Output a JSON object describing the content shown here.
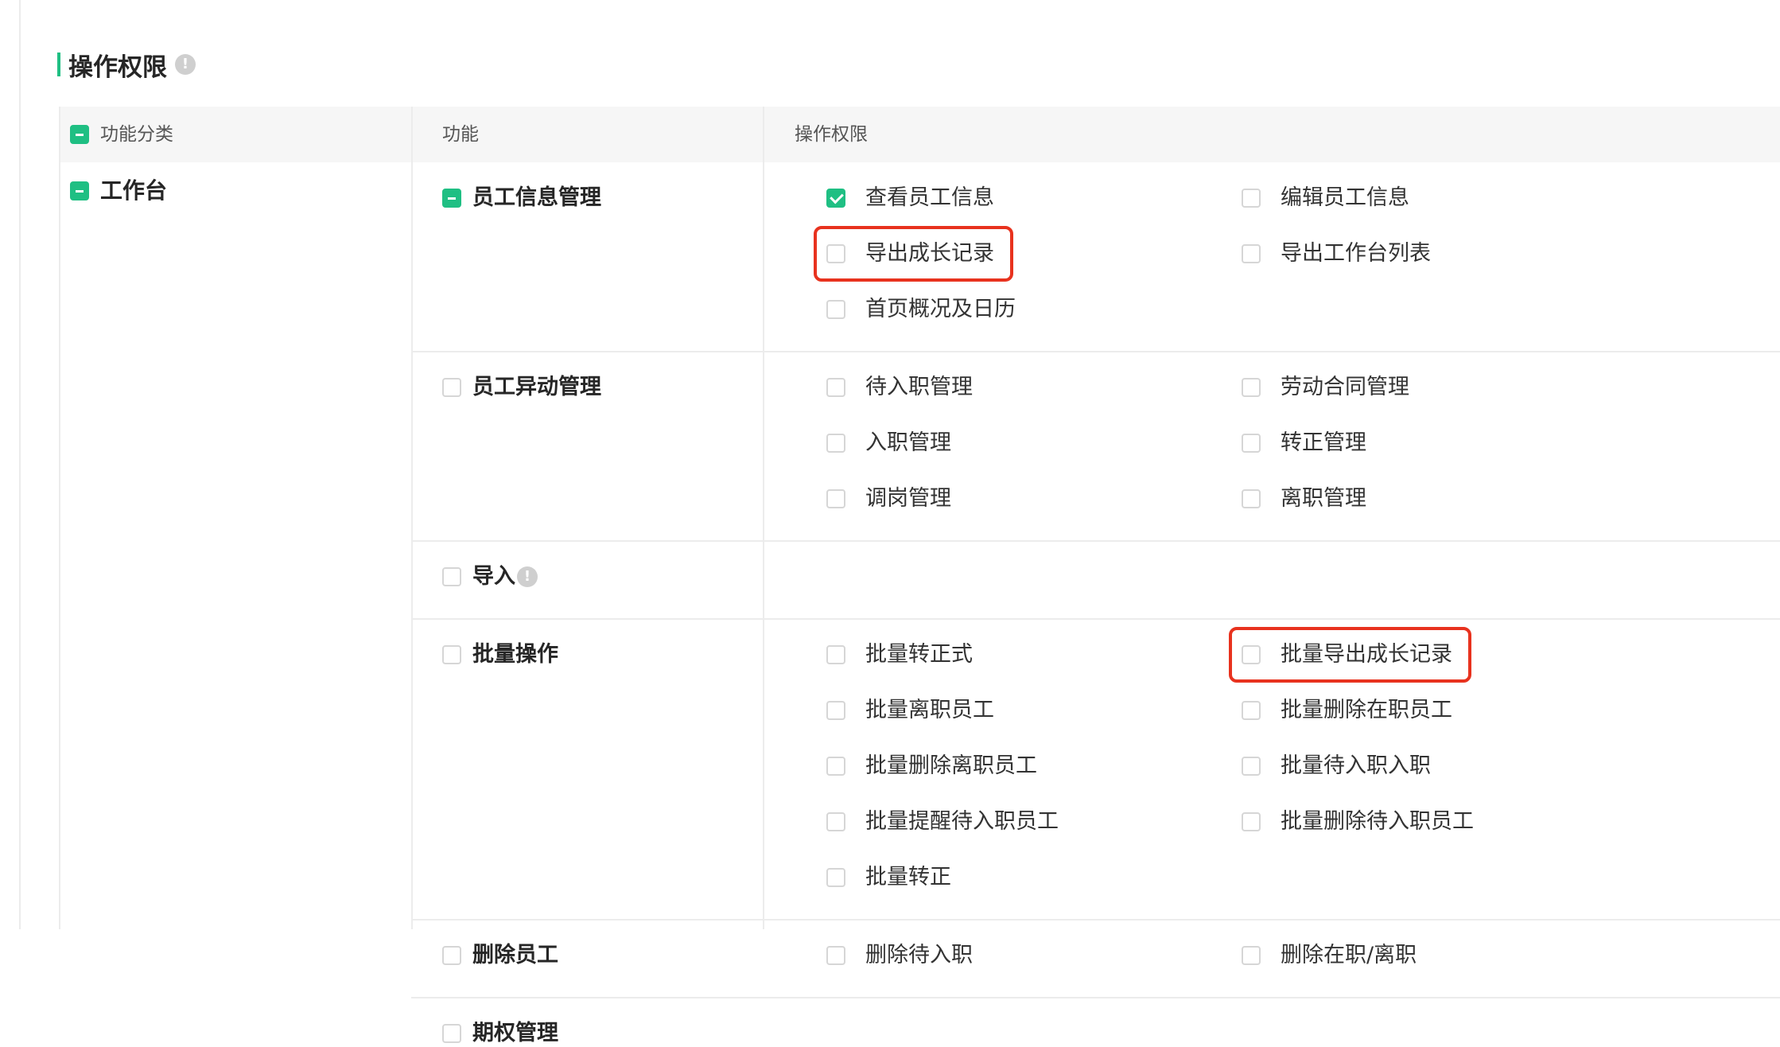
{
  "section": {
    "title": "操作权限",
    "info_icon": "info-icon"
  },
  "header": {
    "category": "功能分类",
    "function": "功能",
    "permissions": "操作权限"
  },
  "category": {
    "name": "工作台",
    "state": "indeterminate"
  },
  "groups": [
    {
      "name": "员工信息管理",
      "state": "indeterminate",
      "perms": [
        "查看员工信息",
        "编辑员工信息",
        "导出成长记录",
        "导出工作台列表",
        "首页概况及日历"
      ],
      "checked": [
        "查看员工信息"
      ]
    },
    {
      "name": "员工异动管理",
      "state": "unchecked",
      "perms": [
        "待入职管理",
        "劳动合同管理",
        "入职管理",
        "转正管理",
        "调岗管理",
        "离职管理"
      ]
    },
    {
      "name": "导入",
      "state": "unchecked",
      "perms": []
    },
    {
      "name": "批量操作",
      "state": "unchecked",
      "perms": [
        "批量转正式",
        "批量导出成长记录",
        "批量离职员工",
        "批量删除在职员工",
        "批量删除离职员工",
        "批量待入职入职",
        "批量提醒待入职员工",
        "批量删除待入职员工",
        "批量转正"
      ]
    },
    {
      "name": "删除员工",
      "state": "unchecked",
      "perms": [
        "删除待入职",
        "删除在职/离职"
      ]
    },
    {
      "name": "期权管理",
      "state": "unchecked",
      "perms": []
    }
  ],
  "highlights": [
    "导出成长记录",
    "批量导出成长记录"
  ],
  "colors": {
    "accent": "#1fbf83",
    "highlight": "#e8321e",
    "header_bg": "#f6f6f6",
    "border": "#ececec"
  }
}
